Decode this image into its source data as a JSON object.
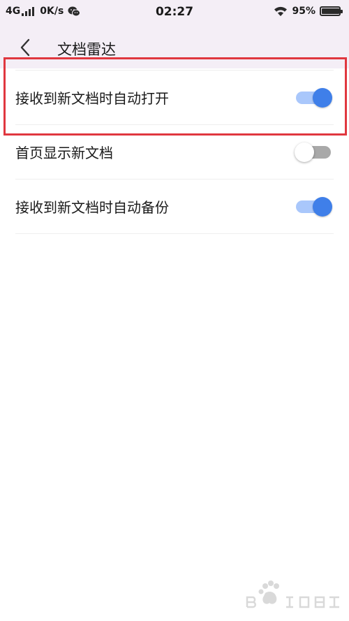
{
  "status_bar": {
    "network": "4G",
    "speed": "0K/s",
    "time": "02:27",
    "battery_percent_text": "95%",
    "battery_level": 0.95,
    "icons": [
      "signal-icon",
      "wechat-icon",
      "wifi-icon",
      "battery-icon"
    ]
  },
  "nav": {
    "back_icon": "chevron-left-icon",
    "title": "文档雷达"
  },
  "settings": [
    {
      "label": "接收到新文档时自动打开",
      "enabled": true
    },
    {
      "label": "首页显示新文档",
      "enabled": false
    },
    {
      "label": "接收到新文档时自动备份",
      "enabled": true
    }
  ],
  "colors": {
    "accent": "#3f7fe9",
    "accent_track": "#a9c7fb",
    "off_track": "#a9a9a9",
    "header_bg": "#f4eef6",
    "highlight": "#e0373f"
  }
}
